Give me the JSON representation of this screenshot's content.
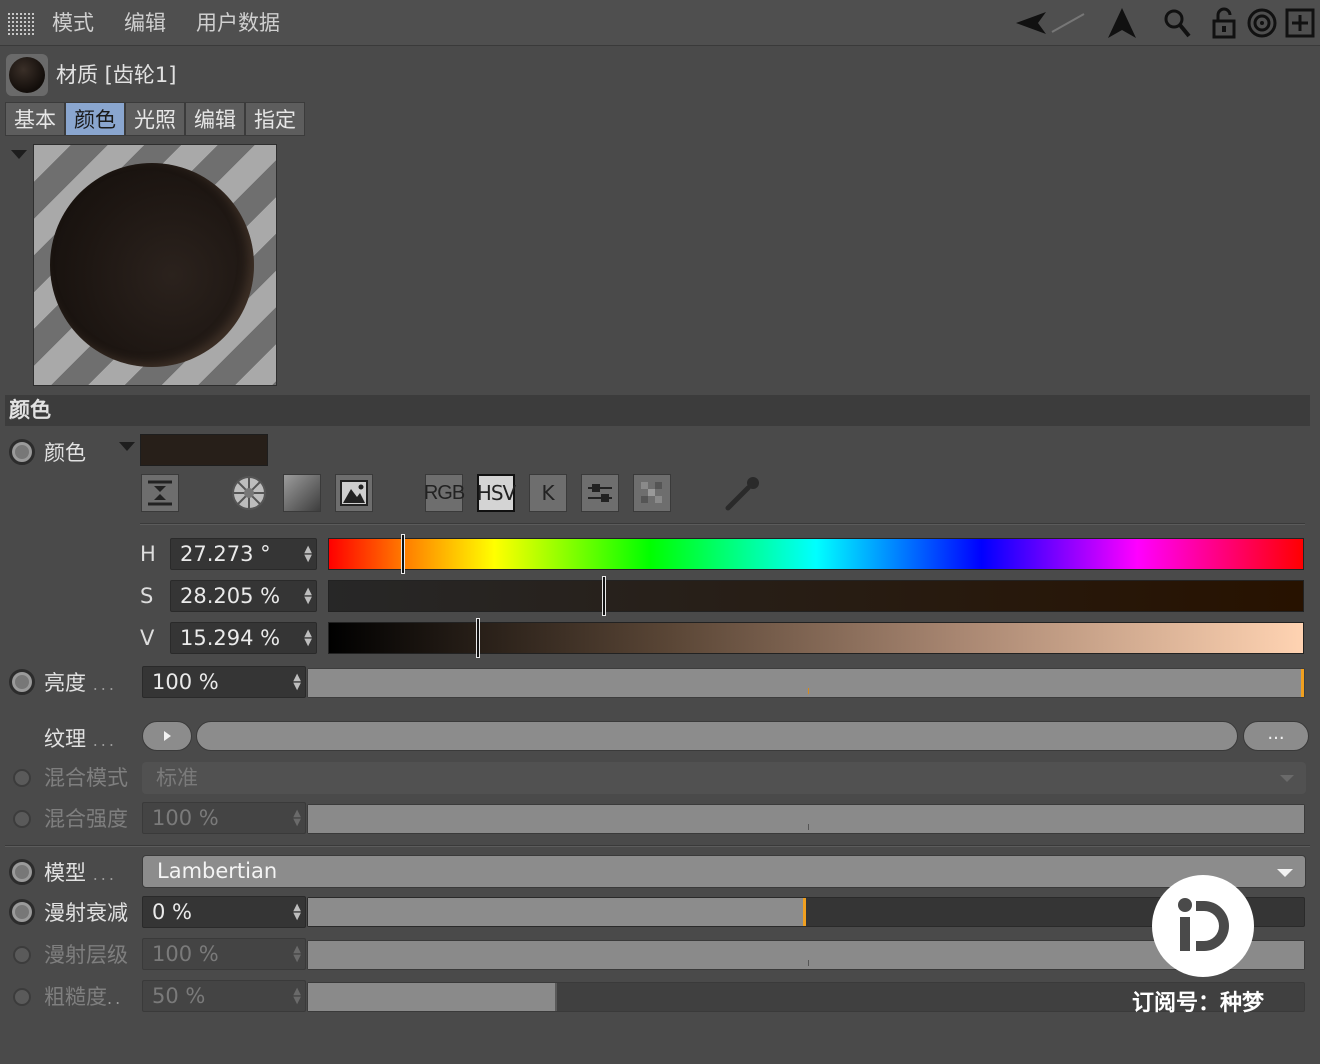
{
  "menu": {
    "items": [
      "模式",
      "编辑",
      "用户数据"
    ]
  },
  "toolbar": {
    "icons": [
      "back-arrow-icon",
      "up-arrow-icon",
      "search-icon",
      "lock-icon",
      "target-icon",
      "new-panel-icon"
    ]
  },
  "material": {
    "title": "材质 [齿轮1]"
  },
  "tabs": [
    {
      "label": "基本",
      "active": false
    },
    {
      "label": "颜色",
      "active": true
    },
    {
      "label": "光照",
      "active": false
    },
    {
      "label": "编辑",
      "active": false
    },
    {
      "label": "指定",
      "active": false
    }
  ],
  "section": {
    "title": "颜色"
  },
  "color": {
    "label": "颜色",
    "swatch": "#271f19",
    "mode_buttons": [
      "RGB",
      "HSV",
      "K"
    ],
    "active_mode": "HSV",
    "h": {
      "label": "H",
      "value": "27.273 °",
      "fraction": 0.0758
    },
    "s": {
      "label": "S",
      "value": "28.205 %",
      "fraction": 0.282
    },
    "v": {
      "label": "V",
      "value": "15.294 %",
      "fraction": 0.153
    }
  },
  "brightness": {
    "label": "亮度",
    "dots": "...",
    "value": "100 %",
    "fraction": 1.0
  },
  "texture": {
    "label": "纹理",
    "dots": "...",
    "more": "..."
  },
  "blend_mode": {
    "label": "混合模式",
    "value": "标准"
  },
  "blend_strength": {
    "label": "混合强度",
    "value": "100 %",
    "fraction": 1.0
  },
  "model": {
    "label": "模型",
    "dots": "...",
    "value": "Lambertian"
  },
  "diffuse_falloff": {
    "label": "漫射衰减",
    "value": "0 %",
    "fraction": 0.5
  },
  "diffuse_level": {
    "label": "漫射层级",
    "value": "100 %",
    "fraction": 1.0
  },
  "roughness": {
    "label": "粗糙度",
    "dots": "..",
    "value": "50 %",
    "fraction": 0.25
  },
  "watermark": {
    "text": "订阅号：种梦"
  }
}
